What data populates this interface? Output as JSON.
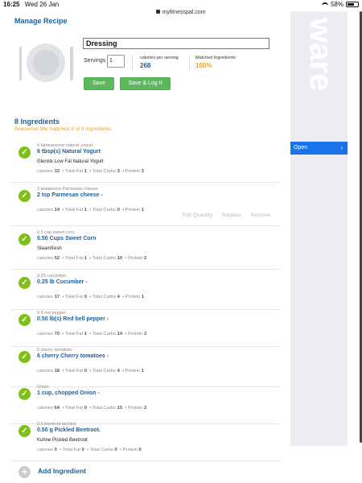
{
  "status_bar": {
    "time": "16:25",
    "date": "Wed 26 Jan",
    "url": "myfitnesspal.com",
    "battery": "58%"
  },
  "side_panel": {
    "open_label": "Open",
    "brand_text": "ware"
  },
  "recipe": {
    "section_title": "Manage Recipe",
    "name": "Dressing",
    "servings_label": "Servings",
    "servings_value": "1",
    "calories_label": "calories per serving",
    "calories_value": "268",
    "matched_label": "Matched Ingredients",
    "matched_value": "100%",
    "save_label": "Save",
    "save_log_label": "Save & Log It"
  },
  "ingredients": {
    "title": "8 Ingredients",
    "subtitle": "Awesome! We matched 8 of 8 ingredients.",
    "actions": {
      "edit": "Edit Quantity",
      "replace": "Replace",
      "remove": "Remove"
    },
    "add_label": "Add Ingredient",
    "items": [
      {
        "source": "6 tablespoons natural yogurt",
        "name": "6 tbsp(s) Natural Yogurt",
        "brand": "Glenisk Low Fat Natural Yogurt",
        "calories": "32",
        "fat": "1",
        "carbs": "3",
        "protein": "3"
      },
      {
        "source": "2 teaspoons Parmesan cheese",
        "name": "2 tsp Parmesan cheese -",
        "brand": "",
        "calories": "14",
        "fat": "1",
        "carbs": "0",
        "protein": "1"
      },
      {
        "source": "0.5 cup sweet corn",
        "name": "0.50 Cups Sweet Corn",
        "brand": "Steamfresh",
        "calories": "52",
        "fat": "1",
        "carbs": "10",
        "protein": "2"
      },
      {
        "source": "0.25 cucumber",
        "name": "0.25 lb Cucumber -",
        "brand": "",
        "calories": "17",
        "fat": "0",
        "carbs": "4",
        "protein": "1"
      },
      {
        "source": "0.5 red pepper",
        "name": "0.50 lb(s) Red bell pepper -",
        "brand": "",
        "calories": "70",
        "fat": "1",
        "carbs": "14",
        "protein": "2"
      },
      {
        "source": "6 cherry tomatoes",
        "name": "6 cherry Cherry tomatoes -",
        "brand": "",
        "calories": "18",
        "fat": "0",
        "carbs": "4",
        "protein": "1"
      },
      {
        "source": "Onion",
        "name": "1 cup, chopped Onion -",
        "brand": "",
        "calories": "64",
        "fat": "0",
        "carbs": "15",
        "protein": "2"
      },
      {
        "source": "0.5 beetroot pickled",
        "name": "0.50 g Pickled Beetroot.",
        "brand": "Kuhne Pickled Beetroot",
        "calories": "0",
        "fat": "0",
        "carbs": "0",
        "protein": "0"
      }
    ],
    "nutrient_labels": {
      "calories": "calories",
      "fat": "Total Fat",
      "carbs": "Total Carbs",
      "protein": "Protein"
    }
  }
}
